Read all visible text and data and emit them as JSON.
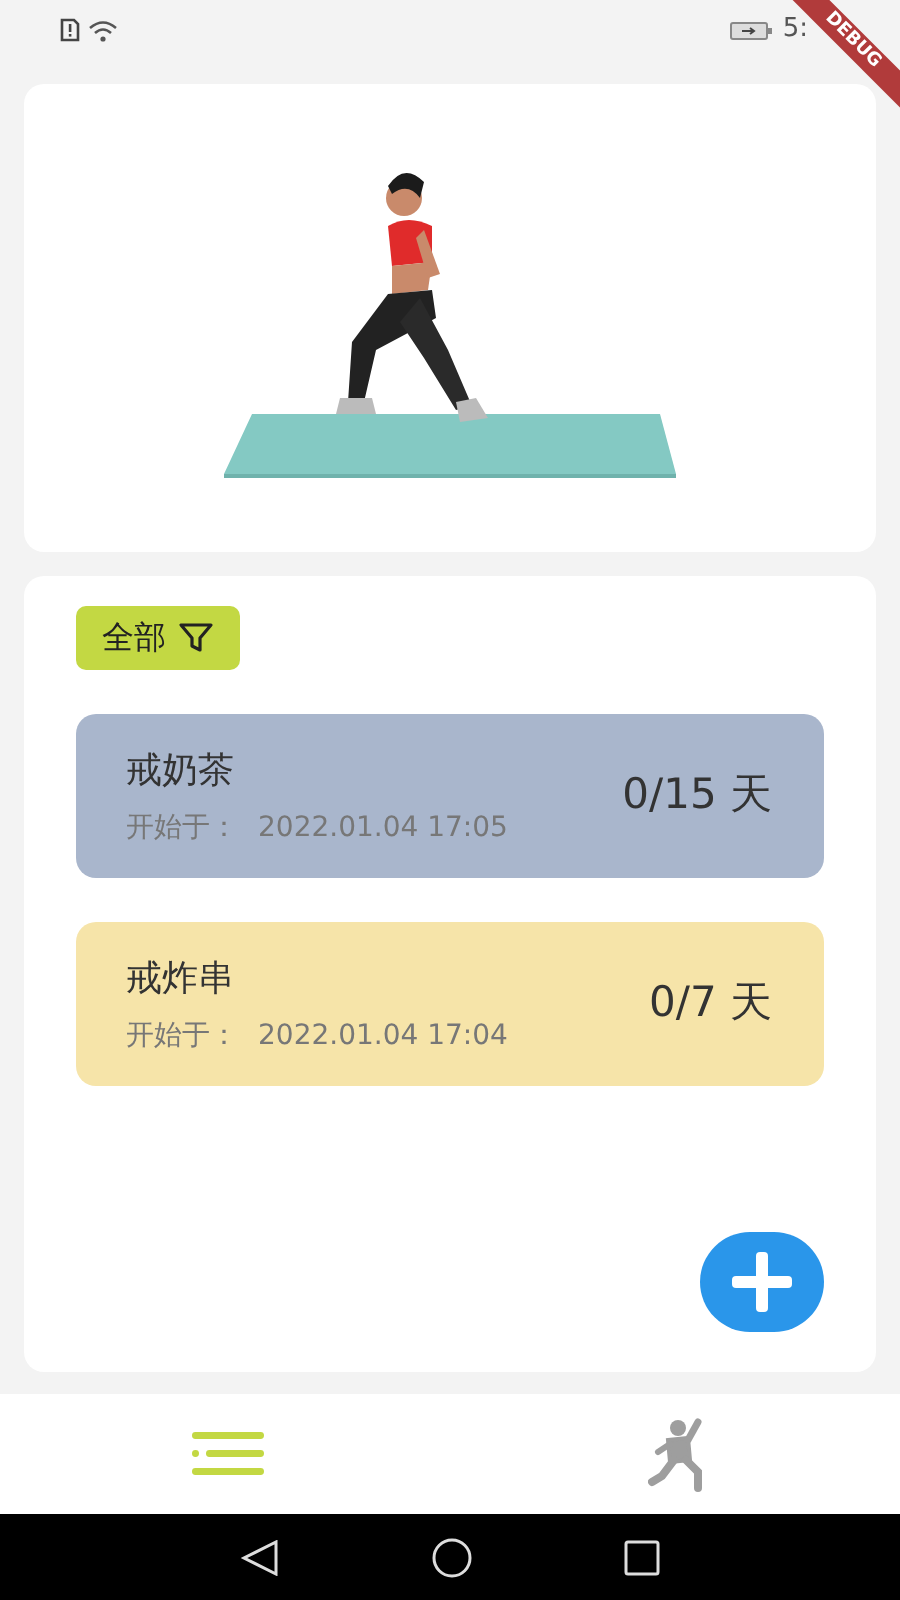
{
  "status_bar": {
    "time": "5:"
  },
  "debug_banner": {
    "label": "DEBUG"
  },
  "filter": {
    "label": "全部"
  },
  "habits": [
    {
      "title": "戒奶茶",
      "start_label": "开始于：",
      "start_time": "2022.01.04 17:05",
      "progress": "0/15 天",
      "color": "#a9b6cc"
    },
    {
      "title": "戒炸串",
      "start_label": "开始于：",
      "start_time": "2022.01.04 17:04",
      "progress": "0/7 天",
      "color": "#f6e4a9"
    }
  ],
  "bottom_nav": [
    {
      "kind": "list",
      "selected": true
    },
    {
      "kind": "exercise",
      "selected": false
    }
  ]
}
